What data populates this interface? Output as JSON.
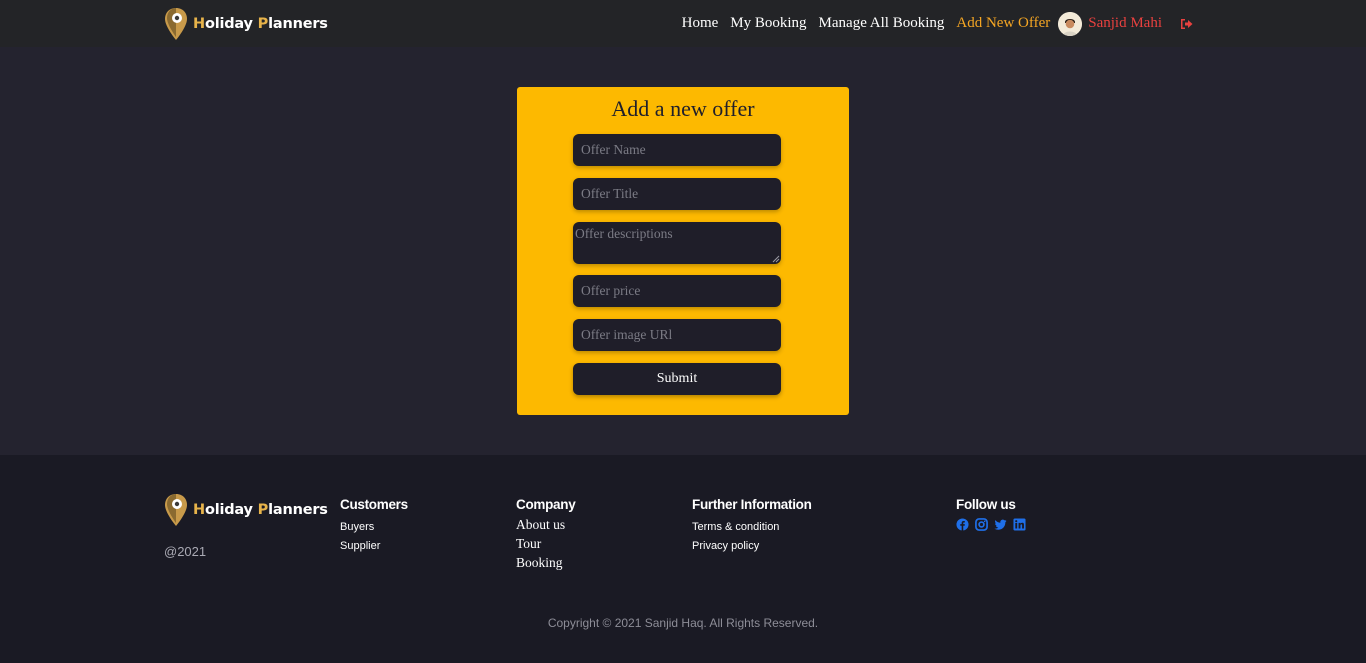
{
  "brand": {
    "name_first_letter": "H",
    "name_rest_1": "oliday ",
    "name_first_letter_2": "P",
    "name_rest_2": "lanners",
    "icon": "map-pin-logo-icon"
  },
  "nav": {
    "links": [
      "Home",
      "My Booking",
      "Manage All Booking",
      "Add New Offer"
    ],
    "active": "Add New Offer",
    "user_name": "Sanjid Mahi",
    "logout_icon": "sign-out-icon"
  },
  "form": {
    "title": "Add a new offer",
    "name_placeholder": "Offer Name",
    "title_placeholder": "Offer Title",
    "description_placeholder": "Offer descriptions",
    "price_placeholder": "Offer price",
    "image_placeholder": "Offer image URl",
    "submit_label": "Submit"
  },
  "footer": {
    "year": "@2021",
    "customers": {
      "heading": "Customers",
      "items": [
        "Buyers",
        "Supplier"
      ]
    },
    "company": {
      "heading": "Company",
      "items": [
        "About us",
        "Tour",
        "Booking"
      ]
    },
    "further": {
      "heading": "Further Information",
      "items": [
        "Terms & condition",
        "Privacy policy"
      ]
    },
    "follow": {
      "heading": "Follow us",
      "icons": [
        "facebook-icon",
        "instagram-icon",
        "twitter-icon",
        "linkedin-icon"
      ]
    },
    "copyright": "Copyright © 2021 Sanjid Haq. All Rights Reserved."
  },
  "colors": {
    "accent": "#fdb900",
    "active_link": "#f5a623",
    "user": "#e8413f",
    "social": "#1f6fe8"
  }
}
